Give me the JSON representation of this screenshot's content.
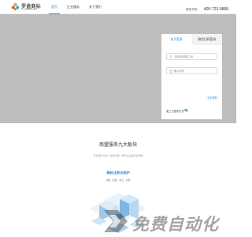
{
  "header": {
    "logo_cn": "罗盘商标",
    "logo_en": "COMPASS",
    "nav": [
      {
        "label": "首页",
        "active": true
      },
      {
        "label": "企业服务",
        "active": false
      },
      {
        "label": "关于我们",
        "active": false
      }
    ],
    "hotline_label": "服务热线:",
    "hotline_number": "400-723-9888"
  },
  "login": {
    "tabs": [
      {
        "label": "账号登录",
        "active": true
      },
      {
        "label": "微信扫码登录",
        "active": false
      }
    ],
    "username_placeholder": "手机号/邮箱/工号",
    "password_placeholder": "输入密码",
    "forgot_label": "忘记密码",
    "other_label": "第三方登录方式:",
    "wechat_icon": "wechat-icon"
  },
  "services": {
    "title": "商盟服务九大板块",
    "subtitle": "专业团队为您一站式办理，服务企业品牌全流程",
    "feature_title": "商标注册与保护",
    "feature_subtitle": "注册、续展、转让、变更"
  },
  "watermark": {
    "text": "免费自动化",
    "icon": "play-logo-icon"
  },
  "colors": {
    "accent": "#2e8bd6",
    "hero_bg": "#bdbdbd",
    "watermark": "#5a5a5a"
  }
}
